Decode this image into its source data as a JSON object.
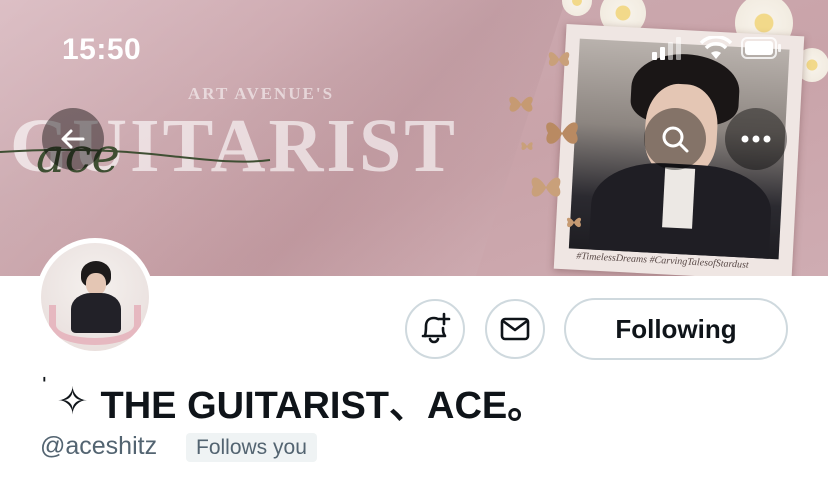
{
  "status_bar": {
    "time": "15:50",
    "icons": [
      "signal-icon",
      "wifi-icon",
      "battery-icon"
    ]
  },
  "banner": {
    "subtitle": "ART AVENUE'S",
    "title": "GUITARIST",
    "script": "ace",
    "hashtags": "#TimelessDreams  #CarvingTalesofStardust"
  },
  "nav": {
    "back_icon": "back-arrow-icon",
    "search_icon": "search-icon",
    "more_icon": "more-icon"
  },
  "profile": {
    "display_name": "THE GUITARIST、ACE。",
    "name_prefix_mark": "ˈ",
    "name_prefix_icon": "✧",
    "handle": "@aceshitz",
    "follows_you": "Follows you"
  },
  "actions": {
    "notify_icon": "bell-plus-icon",
    "message_icon": "mail-icon",
    "following_label": "Following"
  },
  "colors": {
    "text_primary": "#0f1419",
    "text_secondary": "#536471",
    "border": "#cfd9de",
    "badge_bg": "#eff3f4",
    "banner_pink": "#cba8ae"
  }
}
